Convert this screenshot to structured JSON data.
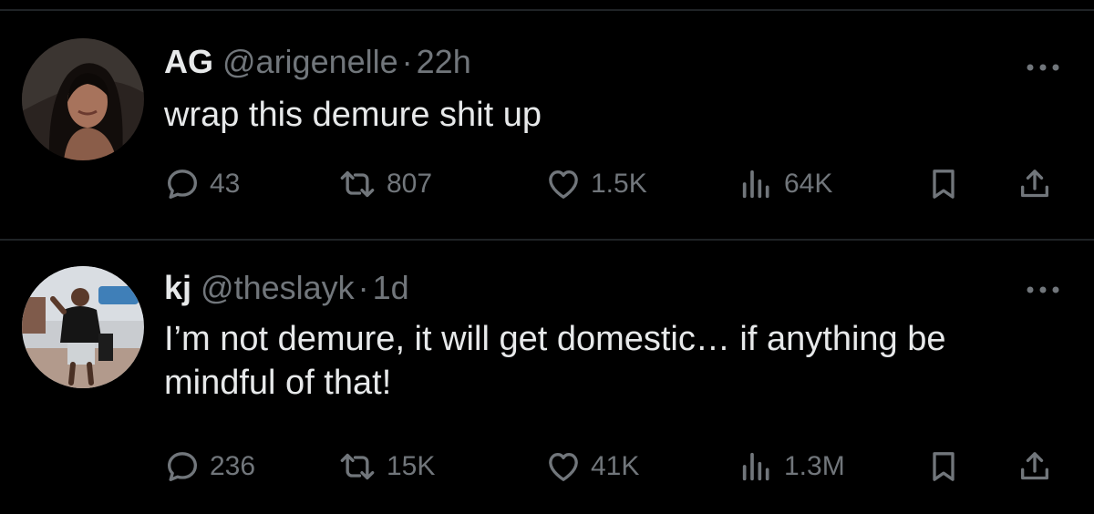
{
  "tweets": [
    {
      "display_name": "AG",
      "handle": "@arigenelle",
      "separator": "·",
      "time": "22h",
      "text": "wrap this demure shit up",
      "replies": "43",
      "reposts": "807",
      "likes": "1.5K",
      "views": "64K"
    },
    {
      "display_name": "kj",
      "handle": "@theslayk",
      "separator": "·",
      "time": "1d",
      "text": "I’m not demure, it will get domestic… if anything be mindful of that!",
      "replies": "236",
      "reposts": "15K",
      "likes": "41K",
      "views": "1.3M"
    }
  ],
  "icons": {
    "more": "more-dots-icon",
    "reply": "reply-icon",
    "repost": "repost-icon",
    "like": "heart-icon",
    "views": "views-icon",
    "bookmark": "bookmark-icon",
    "share": "share-icon"
  },
  "colors": {
    "background": "#000000",
    "primary_text": "#e7e9ea",
    "secondary_text": "#71767b",
    "divider": "#1f2326"
  }
}
